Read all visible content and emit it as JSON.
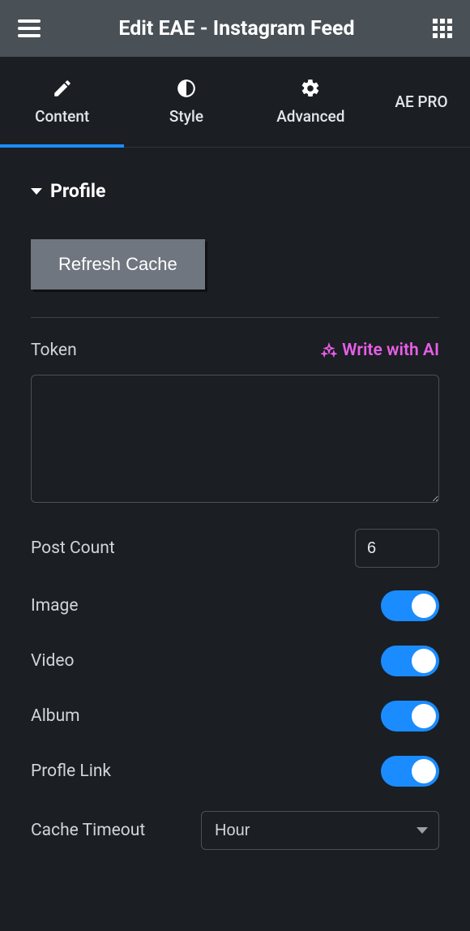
{
  "header": {
    "title": "Edit EAE - Instagram Feed"
  },
  "tabs": {
    "content": "Content",
    "style": "Style",
    "advanced": "Advanced",
    "aepro": "AE PRO"
  },
  "section": {
    "title": "Profile"
  },
  "controls": {
    "refresh": "Refresh Cache",
    "token_label": "Token",
    "ai_label": "Write with AI",
    "token_value": "",
    "post_count_label": "Post Count",
    "post_count_value": "6",
    "image_label": "Image",
    "image_on": true,
    "video_label": "Video",
    "video_on": true,
    "album_label": "Album",
    "album_on": true,
    "profile_link_label": "Profle Link",
    "profile_link_on": true,
    "cache_timeout_label": "Cache Timeout",
    "cache_timeout_value": "Hour"
  }
}
